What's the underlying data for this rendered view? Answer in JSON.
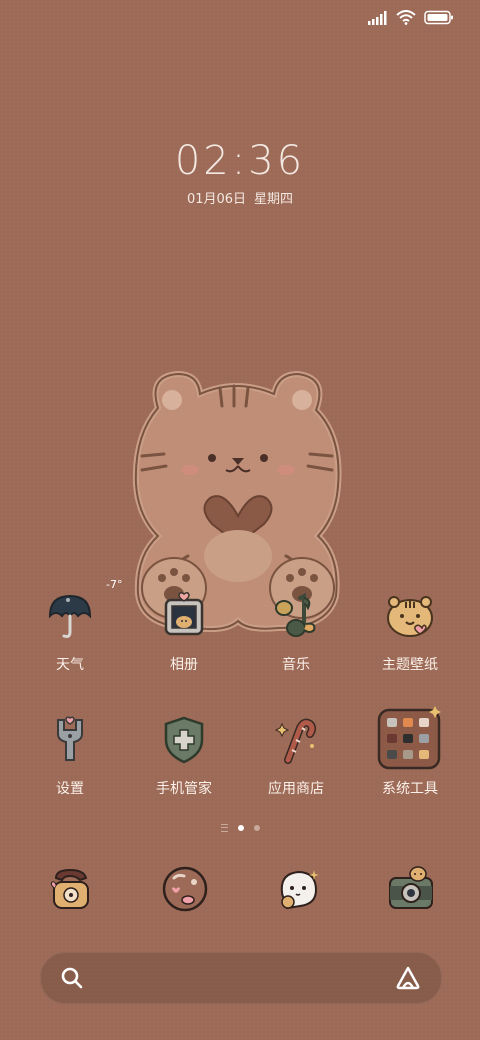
{
  "status_bar": {
    "icons": [
      "signal-icon",
      "wifi-icon",
      "battery-icon"
    ]
  },
  "clock": {
    "time": "02:36",
    "date": "01月06日",
    "weekday": "星期四"
  },
  "apps": [
    {
      "label": "天气",
      "icon": "umbrella-icon",
      "badge": "-7°"
    },
    {
      "label": "相册",
      "icon": "photo-frame-icon"
    },
    {
      "label": "音乐",
      "icon": "music-note-icon"
    },
    {
      "label": "主题壁纸",
      "icon": "tiger-face-icon"
    },
    {
      "label": "设置",
      "icon": "wrench-icon"
    },
    {
      "label": "手机管家",
      "icon": "shield-icon"
    },
    {
      "label": "应用商店",
      "icon": "candy-cane-icon"
    },
    {
      "label": "系统工具",
      "icon": "folder-icon"
    }
  ],
  "page_indicator": {
    "pages": 2,
    "current": 1
  },
  "dock": [
    "phone-icon",
    "messages-icon",
    "browser-icon",
    "camera-icon"
  ],
  "search_bar": {
    "icons": [
      "search-icon",
      "assistant-icon"
    ]
  },
  "colors": {
    "background": "#9c6a56",
    "text": "#fbf1ea"
  }
}
